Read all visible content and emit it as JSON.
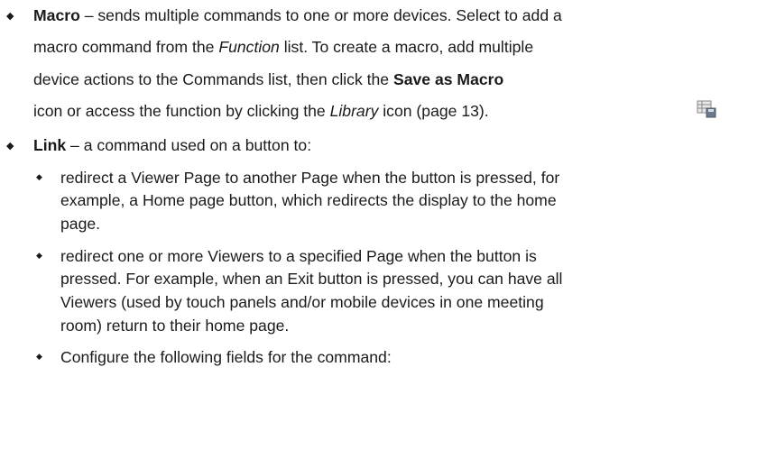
{
  "macro": {
    "title": "Macro",
    "line1_rest": " – sends multiple commands to one or more devices. Select to add a",
    "line2_a": "macro command from the ",
    "line2_italic": "Function",
    "line2_b": " list. To create a macro, add multiple",
    "line3_a": "device actions to the Commands list, then click the ",
    "line3_bold": "Save as Macro",
    "icon": "save-as-macro-icon",
    "line4_a": "icon or access the function by clicking the ",
    "line4_italic": "Library",
    "line4_b": " icon (page 13)."
  },
  "link": {
    "title": "Link",
    "line1_rest": " – a command used on a button to:",
    "sub1": [
      "redirect a Viewer Page to another Page when the button is pressed, for",
      "example, a Home page button, which redirects the display to the home",
      "page."
    ],
    "sub2": [
      "redirect one or more Viewers to a specified Page when the button is",
      "pressed. For example, when an Exit button is pressed, you can have all",
      "Viewers (used by touch panels and/or mobile devices in one meeting",
      "room) return to their home page."
    ],
    "sub3": [
      "Configure the following fields for the command:"
    ]
  }
}
